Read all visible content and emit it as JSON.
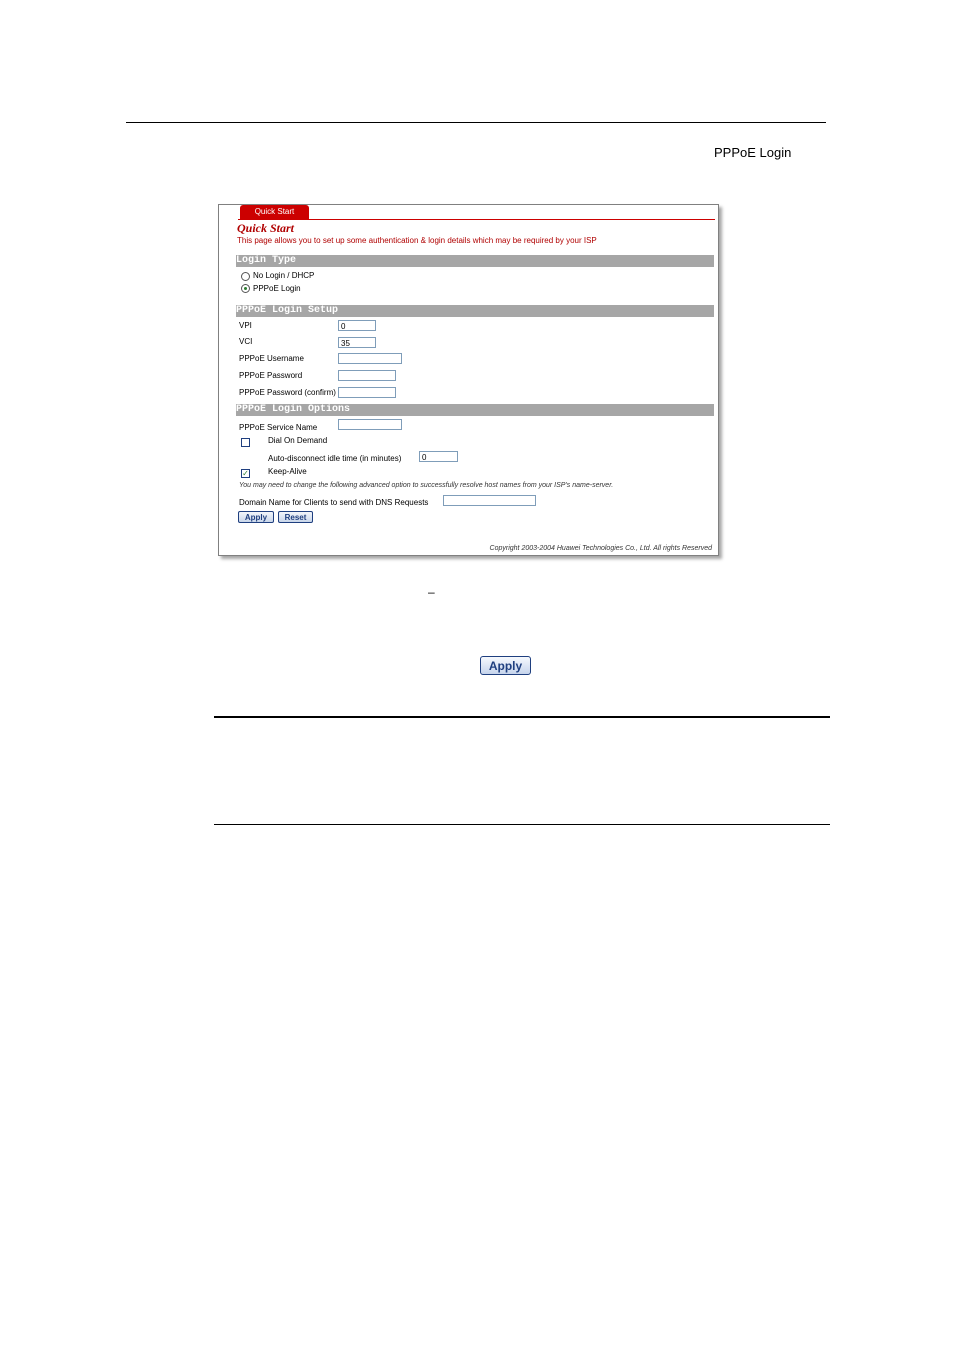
{
  "doc": {
    "inline_ref": "PPPoE Login",
    "dash": "–",
    "apply_button": "Apply"
  },
  "screenshot": {
    "tab": "Quick Start",
    "title": "Quick Start",
    "description": "This page allows you to set up some authentication & login details which may be required by your ISP",
    "login_type": {
      "header": "Login Type",
      "options": [
        "No Login / DHCP",
        "PPPoE Login"
      ],
      "selected": "PPPoE Login"
    },
    "setup": {
      "header": "PPPoE Login Setup",
      "vpi_label": "VPI",
      "vpi_value": "0",
      "vci_label": "VCI",
      "vci_value": "35",
      "username_label": "PPPoE Username",
      "username_value": "",
      "password_label": "PPPoE Password",
      "password_value": "",
      "confirm_label": "PPPoE Password (confirm)",
      "confirm_value": ""
    },
    "options": {
      "header": "PPPoE Login Options",
      "service_label": "PPPoE Service Name",
      "service_value": "",
      "dial_label": "Dial On Demand",
      "idle_label": "Auto-disconnect idle time (in minutes)",
      "idle_value": "0",
      "keepalive_label": "Keep-Alive",
      "note": "You may need to change the following advanced option to successfully resolve host names from your ISP's name-server.",
      "domain_label": "Domain Name for Clients to send with DNS Requests",
      "domain_value": ""
    },
    "buttons": {
      "apply": "Apply",
      "reset": "Reset"
    },
    "copyright": "Copyright 2003-2004 Huawei Technologies Co., Ltd. All rights Reserved"
  }
}
